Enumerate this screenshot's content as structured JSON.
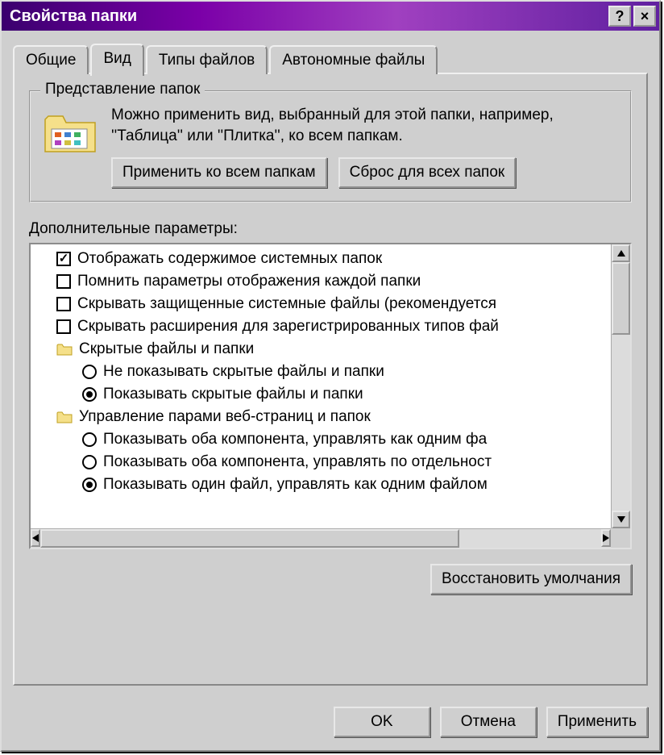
{
  "title": "Свойства папки",
  "titlebar": {
    "help": "?",
    "close": "×"
  },
  "tabs": [
    {
      "label": "Общие",
      "active": false
    },
    {
      "label": "Вид",
      "active": true
    },
    {
      "label": "Типы файлов",
      "active": false
    },
    {
      "label": "Автономные файлы",
      "active": false
    }
  ],
  "group": {
    "title": "Представление папок",
    "description": "Можно применить вид, выбранный для этой папки, например, ''Таблица'' или ''Плитка'', ко всем папкам.",
    "apply_label": "Применить ко всем папкам",
    "reset_label": "Сброс для всех папок"
  },
  "advanced": {
    "label": "Дополнительные параметры:",
    "items": [
      {
        "type": "checkbox",
        "checked": true,
        "indent": 1,
        "text": "Отображать содержимое системных папок"
      },
      {
        "type": "checkbox",
        "checked": false,
        "indent": 1,
        "text": "Помнить параметры отображения каждой папки"
      },
      {
        "type": "checkbox",
        "checked": false,
        "indent": 1,
        "text": "Скрывать защищенные системные файлы (рекомендуется"
      },
      {
        "type": "checkbox",
        "checked": false,
        "indent": 1,
        "text": "Скрывать расширения для зарегистрированных типов фай"
      },
      {
        "type": "folder",
        "indent": 1,
        "text": "Скрытые файлы и папки"
      },
      {
        "type": "radio",
        "checked": false,
        "indent": 2,
        "text": "Не показывать скрытые файлы и папки"
      },
      {
        "type": "radio",
        "checked": true,
        "indent": 2,
        "text": "Показывать скрытые файлы и папки"
      },
      {
        "type": "folder",
        "indent": 1,
        "text": "Управление парами веб-страниц и папок"
      },
      {
        "type": "radio",
        "checked": false,
        "indent": 2,
        "text": "Показывать оба компонента, управлять как одним фа"
      },
      {
        "type": "radio",
        "checked": false,
        "indent": 2,
        "text": "Показывать оба компонента, управлять по отдельност"
      },
      {
        "type": "radio",
        "checked": true,
        "indent": 2,
        "text": "Показывать один файл, управлять как одним файлом"
      }
    ],
    "restore_label": "Восстановить умолчания"
  },
  "buttons": {
    "ok": "OK",
    "cancel": "Отмена",
    "apply": "Применить"
  }
}
